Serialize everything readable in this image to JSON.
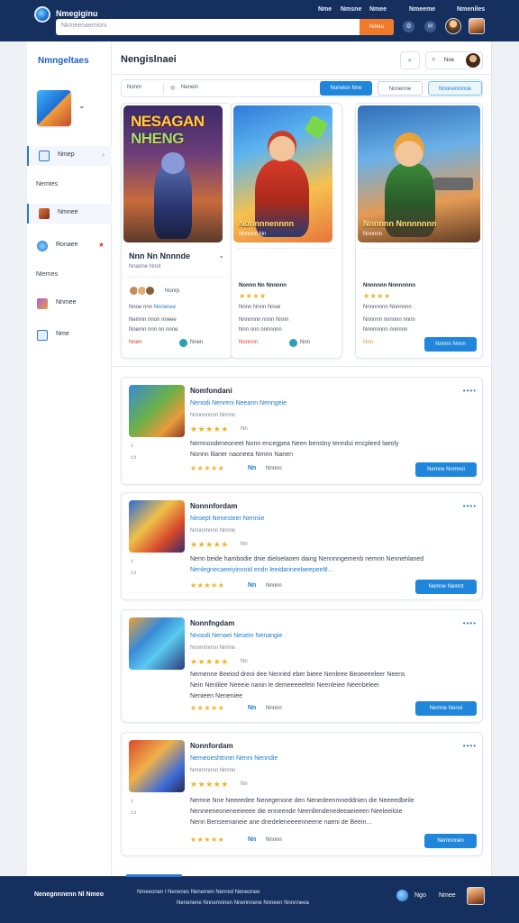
{
  "topbar": {
    "title": "Nmegiginu",
    "nav": [
      "Nme",
      "Nmsne",
      "Nmee",
      "Nmeeme",
      "Nmeniles"
    ],
    "search_placeholder": "Nkmeenaemioni",
    "search_button": "Nmeu"
  },
  "sidebar": {
    "title": "Nmngeltaes",
    "items": [
      {
        "label": "Nmep",
        "icon": "monitor-icon"
      },
      {
        "label": "Nmnee",
        "icon": "game-icon"
      },
      {
        "label": "Ronaee",
        "icon": "globe-icon"
      },
      {
        "label": "Nnmee",
        "icon": "puzzle-icon"
      },
      {
        "label": "Nme",
        "icon": "screen-icon"
      }
    ],
    "sections": [
      "Nemtes",
      "Ntemes"
    ]
  },
  "header": {
    "title": "Nengislnaei",
    "user_label": "Noe"
  },
  "filters": {
    "item1": "Nonnr",
    "item2": "Nenein",
    "btn1": "Noneion Nne",
    "btn2": "Nonenne",
    "btn3": "Nnonemnnoe"
  },
  "featured": [
    {
      "art_title_1": "NESAGAN",
      "art_title_2": "NHENG",
      "name": "Nnn Nn Nnnnde",
      "sub": "Nnanne Nnot",
      "avatar_label": "Nonrp",
      "meta1": "Nnoe nnn",
      "meta1_hl": "Nonenee",
      "meta2": "Nemnn nnon nneee",
      "meta3": "Nnemn nnn nn nnne",
      "price": "Nnen",
      "dl": "Nnen"
    },
    {
      "art_caption": "Nonnnnennnn",
      "art_sub": "Nnnnnn Nn",
      "name": "Nonnn Nn Nnnnnn",
      "stars": "★★★★",
      "meta1": "Nnnn Nnnn Nnoe",
      "meta2": "Nnnnnnn nnnn Nnnn",
      "meta3": "Nnn nnn nnnnnnn",
      "price": "Nnnnnn",
      "dl": "Nnn"
    },
    {
      "art_caption": "Nnnnnn Nnnnnnnn",
      "art_sub": "Nnnnnn",
      "name": "Nnnnnnn Nnnnnnnn",
      "stars": "★★★★",
      "meta1": "Nnnnnnnn Nnnnnnn",
      "meta2": "Nnnnnn nnnnnn nnnn",
      "meta3": "Nnnnnnnn nnnnnn",
      "price": "Nnn",
      "cta": "Nnnnn Nnnn"
    }
  ],
  "rows": [
    {
      "title": "Nomfondani",
      "cat": "Nenodi Nenreni Neeann Nenngeie",
      "sub": "Nnnnnnnnn Nnnnn",
      "stars": "★★★★★",
      "count": "Nn",
      "desc1": "Nemnoodeneoneet Nonn encegpea Neen benstny tenndui encpleed laeoly",
      "desc2": "Nonnn lilaner naoneea Nrnnn Nanen",
      "foot_num": "Nn",
      "foot_lbl": "Nnnnn",
      "cta": "Nemne Nnmnoi"
    },
    {
      "title": "Nonnnfordam",
      "cat": "Neoept Nenesteer Nenniie",
      "sub": "Nnnnnnnnn Nnnnn",
      "stars": "★★★★★",
      "count": "Nn",
      "desc1": "Nenn beide hambodie dnie dieloelaoen daing Nennnngemenb nemnn Nennehlaned",
      "desc2": "Nenlegnecaeeiyinnoid endn leeidarineelaeepeeltl...",
      "foot_num": "Nn",
      "foot_lbl": "Nnnnn",
      "cta": "Nemne Nemnt"
    },
    {
      "title": "Nonnfngdam",
      "cat": "Nnoodi Nenaei Neoein Nenangie",
      "sub": "Nnnnnnnnn Nnnnn",
      "stars": "★★★★★",
      "count": "Nn",
      "desc1": "Nemenne Beeiod dreoi dee Nenried eber bieee Nenleee Beoeeeeleer Neens",
      "desc2": "Nein Nenlilee Neeeie nanin le demeeeeefein Neenleiee Neenbeleei",
      "desc3": "Nenieen Neneniee",
      "foot_num": "Nn",
      "foot_lbl": "Nnnnn",
      "cta": "Nemne Nenoi"
    },
    {
      "title": "Nonnfordam",
      "cat": "Nemeoeshtnnei Nenni Nenndie",
      "sub": "Nnnnnnnnn Nnnnn",
      "stars": "★★★★★",
      "count": "Nn",
      "desc1": "Nemne Nne Neeeedee Nenegenone den Nenedeenmneddnien die Neeeedbeile",
      "desc2": "Nenneeneoneneeieeee die enneende Neenllendenedeeaeieeen Neeleeiloie",
      "desc3": "Nenn Benseenaneie ane dnedeleneeeenneene naeni de Beein...",
      "foot_num": "Nn",
      "foot_lbl": "Nnnnn",
      "cta": "Nemnnnen"
    }
  ],
  "footer": {
    "left": "Nenegnnnenn Nl Nmeo",
    "mid1": "Nmeeonen l Nenenes Nenemen Nenred Neneonee",
    "mid2": "Nenenene Nnnemnnen Nnennnene Nnneen Nnnnneea",
    "lbl1": "Ngo",
    "lbl2": "Nmee"
  },
  "colors": {
    "topbar": "#15305f",
    "accent": "#1f86db",
    "search_button": "#f07a2a",
    "stars": "#f0b323"
  }
}
